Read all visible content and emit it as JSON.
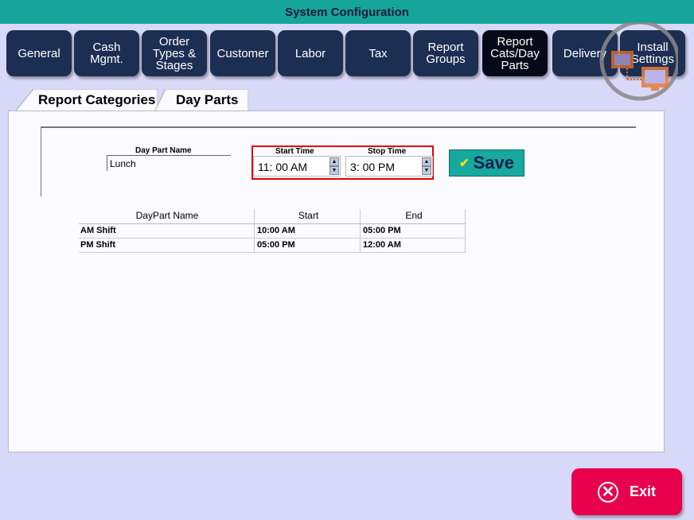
{
  "window": {
    "title": "System Configuration"
  },
  "tabs": [
    {
      "label": "General",
      "active": false
    },
    {
      "label": "Cash\nMgmt.",
      "active": false
    },
    {
      "label": "Order\nTypes &\nStages",
      "active": false
    },
    {
      "label": "Customer",
      "active": false
    },
    {
      "label": "Labor",
      "active": false
    },
    {
      "label": "Tax",
      "active": false
    },
    {
      "label": "Report\nGroups",
      "active": false
    },
    {
      "label": "Report\nCats/Day\nParts",
      "active": true
    },
    {
      "label": "Delivery",
      "active": false
    },
    {
      "label": "Install\nSettings",
      "active": false
    }
  ],
  "subtabs": [
    {
      "label": "Report Categories",
      "active": false
    },
    {
      "label": "Day Parts",
      "active": true
    }
  ],
  "form": {
    "name_label": "Day Part Name",
    "name_value": "Lunch",
    "start_label": "Start Time",
    "start_value": "11: 00  AM",
    "stop_label": "Stop Time",
    "stop_value": "3: 00  PM",
    "save_label": "Save"
  },
  "grid": {
    "headers": [
      "DayPart Name",
      "Start",
      "End"
    ],
    "rows": [
      [
        "AM Shift",
        "10:00 AM",
        "05:00 PM"
      ],
      [
        "PM Shift",
        "05:00 PM",
        "12:00 AM"
      ]
    ]
  },
  "exit_label": "Exit",
  "colors": {
    "title_bar": "#15a59a",
    "tab": "#1c2e52",
    "active_tab": "#050a18",
    "save": "#17a99d",
    "exit": "#e8004c",
    "highlight_box": "#e00000"
  }
}
